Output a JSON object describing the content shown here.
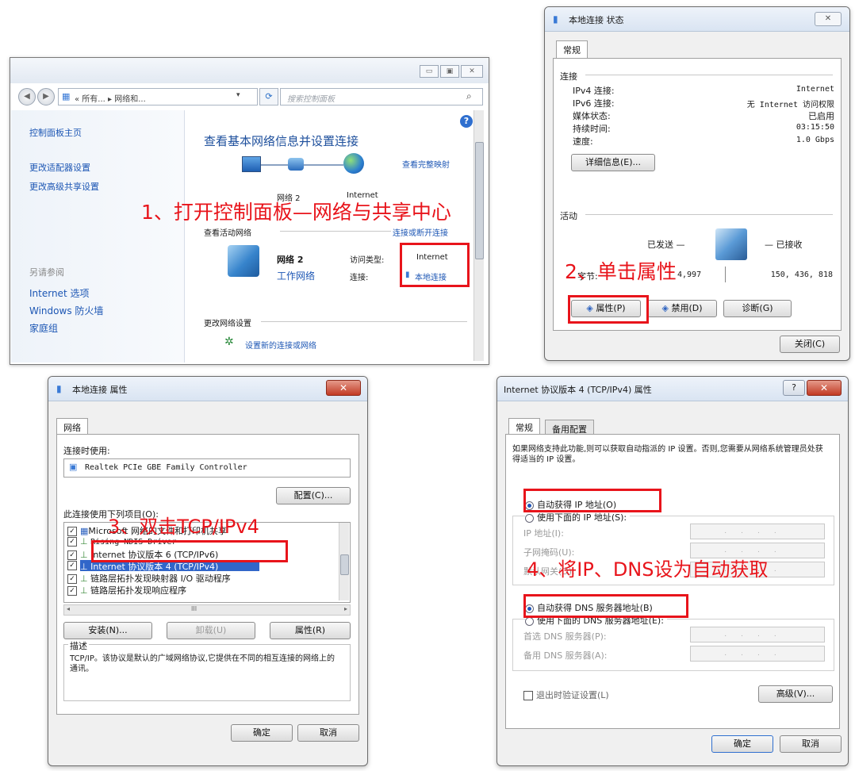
{
  "annotations": {
    "step1": "1、打开控制面板—网络与共享中心",
    "step2": "2、单击属性",
    "step3": "3、双击TCP/IPv4",
    "step4": "4、将IP、DNS设为自动获取"
  },
  "control_panel": {
    "window_controls": {
      "minimize": "▭",
      "maximize": "▣",
      "close": "✕"
    },
    "breadcrumb": "« 所有... ▸ 网络和...",
    "search_placeholder": "搜索控制面板",
    "sidebar": {
      "home": "控制面板主页",
      "items": [
        "更改适配器设置",
        "更改高级共享设置"
      ],
      "see_also_heading": "另请参阅",
      "see_also": [
        "Internet 选项",
        "Windows 防火墙",
        "家庭组"
      ]
    },
    "main": {
      "heading": "查看基本网络信息并设置连接",
      "view_full_map": "查看完整映射",
      "node_network": "网络 2",
      "node_internet": "Internet",
      "active_heading": "查看活动网络",
      "connect_link": "连接或断开连接",
      "network_name": "网络 2",
      "network_type": "工作网络",
      "access_type_label": "访问类型:",
      "access_type_value": "Internet",
      "connection_label": "连接:",
      "connection_value": "本地连接",
      "change_heading": "更改网络设置",
      "setup_link": "设置新的连接或网络"
    }
  },
  "status_dialog": {
    "title": "本地连接 状态",
    "tab": "常规",
    "connection_heading": "连接",
    "rows": [
      {
        "label": "IPv4 连接:",
        "value": "Internet"
      },
      {
        "label": "IPv6 连接:",
        "value": "无 Internet 访问权限"
      },
      {
        "label": "媒体状态:",
        "value": "已启用"
      },
      {
        "label": "持续时间:",
        "value": "03:15:50"
      },
      {
        "label": "速度:",
        "value": "1.0 Gbps"
      }
    ],
    "details_button": "详细信息(E)...",
    "activity_heading": "活动",
    "sent_label": "已发送 —",
    "received_label": "— 已接收",
    "bytes_label": "字节:",
    "bytes_sent": "4,997",
    "bytes_received": "150, 436, 818",
    "properties_button": "属性(P)",
    "disable_button": "禁用(D)",
    "diagnose_button": "诊断(G)",
    "close_button": "关闭(C)"
  },
  "properties_dialog": {
    "title": "本地连接 属性",
    "tab": "网络",
    "connect_using_label": "连接时使用:",
    "adapter": "Realtek PCIe GBE Family Controller",
    "configure_button": "配置(C)...",
    "items_label": "此连接使用下列项目(O):",
    "items": [
      "Microsoft 网络的文件和打印机共享",
      "Rising NDIS Driver",
      "Internet 协议版本 6 (TCP/IPv6)",
      "Internet 协议版本 4 (TCP/IPv4)",
      "链路层拓扑发现映射器 I/O 驱动程序",
      "链路层拓扑发现响应程序"
    ],
    "scroll_mark": "III",
    "install_button": "安装(N)...",
    "uninstall_button": "卸载(U)",
    "properties_button": "属性(R)",
    "description_heading": "描述",
    "description": "TCP/IP。该协议是默认的广域网络协议,它提供在不同的相互连接的网络上的通讯。",
    "ok_button": "确定",
    "cancel_button": "取消"
  },
  "ipv4_dialog": {
    "title": "Internet 协议版本 4 (TCP/IPv4) 属性",
    "tabs": [
      "常规",
      "备用配置"
    ],
    "intro": "如果网络支持此功能,则可以获取自动指派的 IP 设置。否则,您需要从网络系统管理员处获得适当的 IP 设置。",
    "auto_ip": "自动获得 IP 地址(O)",
    "manual_ip": "使用下面的 IP 地址(S):",
    "ip_address_label": "IP 地址(I):",
    "subnet_label": "子网掩码(U):",
    "gateway_label": "默认网关(D):",
    "auto_dns": "自动获得 DNS 服务器地址(B)",
    "manual_dns": "使用下面的 DNS 服务器地址(E):",
    "preferred_dns_label": "首选 DNS 服务器(P):",
    "alternate_dns_label": "备用 DNS 服务器(A):",
    "validate_label": "退出时验证设置(L)",
    "advanced_button": "高级(V)...",
    "ok_button": "确定",
    "cancel_button": "取消",
    "ip_placeholder": "...."
  }
}
